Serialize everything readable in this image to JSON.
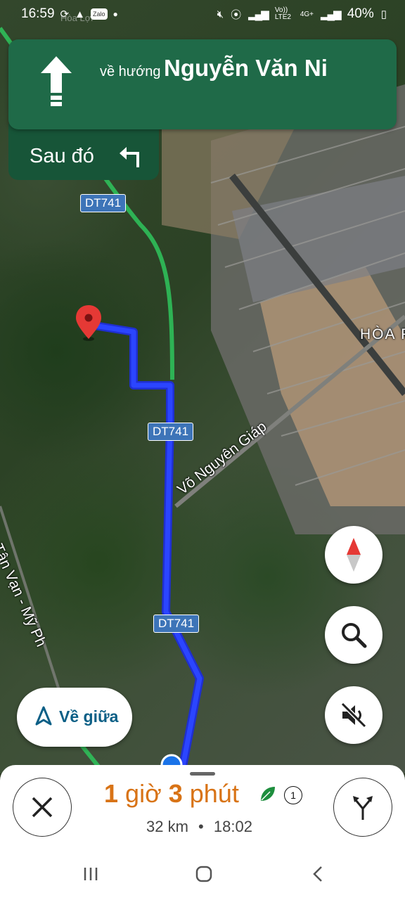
{
  "status_bar": {
    "time": "16:59",
    "app_badge": "Zalo",
    "network_label": "Vo)) LTE2",
    "network_type": "4G+",
    "battery": "40%"
  },
  "navigation": {
    "direction_prefix": "về hướng",
    "street_name": "Nguyễn Văn Ni",
    "then_label": "Sau đó",
    "primary_color": "#1f6a48"
  },
  "map": {
    "road_shields": [
      "DT741",
      "DT741",
      "DT741"
    ],
    "labels": {
      "road_name": "Võ Nguyên Giáp",
      "area_name": "HÒA P",
      "side_road": "Tân Vạn - Mỹ Ph",
      "top_faded": "Hòa Lợi"
    },
    "route_color": "#1a2cf0",
    "highway_color": "#2fbf5a"
  },
  "buttons": {
    "recenter_label": "Về giữa",
    "compass_icon": "compass-icon",
    "search_icon": "search-icon",
    "voice_icon": "voice-muted-icon"
  },
  "trip": {
    "hours": "1",
    "hours_unit": "giờ",
    "minutes": "3",
    "minutes_unit": "phút",
    "distance": "32 km",
    "separator": "•",
    "arrival": "18:02",
    "eta_color": "#d87316",
    "alternate_routes": "1"
  }
}
